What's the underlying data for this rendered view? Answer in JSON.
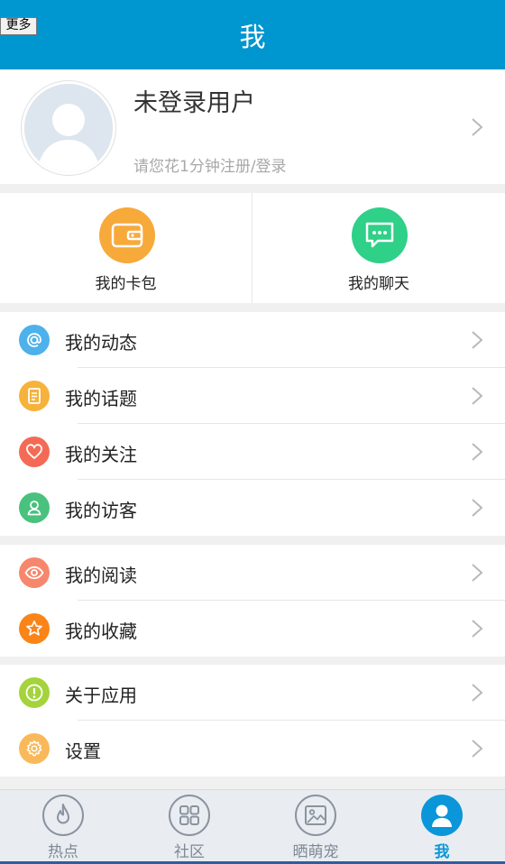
{
  "header": {
    "title": "我",
    "more_label": "更多"
  },
  "profile": {
    "name": "未登录用户",
    "subtitle": "请您花1分钟注册/登录",
    "avatar_icon": "default-avatar-icon"
  },
  "quick_actions": [
    {
      "label": "我的卡包",
      "icon": "wallet-icon",
      "color": "#f7a93a"
    },
    {
      "label": "我的聊天",
      "icon": "chat-bubble-icon",
      "color": "#2fd088"
    }
  ],
  "groups": [
    {
      "items": [
        {
          "label": "我的动态",
          "icon": "at-sign-icon",
          "color": "#4db1ec"
        },
        {
          "label": "我的话题",
          "icon": "document-icon",
          "color": "#f6b23a"
        },
        {
          "label": "我的关注",
          "icon": "heart-icon",
          "color": "#f46a55"
        },
        {
          "label": "我的访客",
          "icon": "person-icon",
          "color": "#48c27c"
        }
      ]
    },
    {
      "items": [
        {
          "label": "我的阅读",
          "icon": "eye-icon",
          "color": "#f7876c"
        },
        {
          "label": "我的收藏",
          "icon": "star-icon",
          "color": "#fb8418"
        }
      ]
    },
    {
      "items": [
        {
          "label": "关于应用",
          "icon": "info-icon",
          "color": "#a5d33b"
        },
        {
          "label": "设置",
          "icon": "gear-icon",
          "color": "#f9b95a"
        }
      ]
    }
  ],
  "tabs": [
    {
      "label": "热点",
      "icon": "flame-icon",
      "active": false
    },
    {
      "label": "社区",
      "icon": "grid-icon",
      "active": false
    },
    {
      "label": "晒萌宠",
      "icon": "picture-icon",
      "active": false
    },
    {
      "label": "我",
      "icon": "user-icon",
      "active": true
    }
  ],
  "colors": {
    "header_bg": "#0096cf",
    "tab_active": "#0a96d8",
    "tab_inactive": "#7e8894"
  }
}
